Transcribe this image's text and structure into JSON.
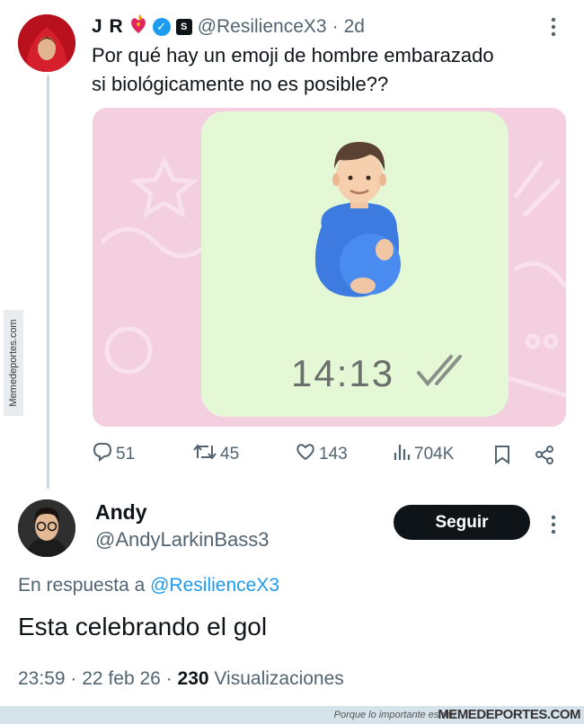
{
  "tweet": {
    "name": "J R",
    "handle": "@ResilienceX3",
    "separator": "·",
    "time": "2d",
    "text_line1": "Por qué hay un emoji de hombre embarazado",
    "text_line2": "si biológicamente no es posible??",
    "media": {
      "time_label": "14:13"
    },
    "stats": {
      "replies": "51",
      "retweets": "45",
      "likes": "143",
      "views": "704K"
    }
  },
  "reply": {
    "name": "Andy",
    "handle": "@AndyLarkinBass3",
    "follow_label": "Seguir",
    "in_reply_prefix": "En respuesta a",
    "in_reply_handle": "@ResilienceX3",
    "text": "Esta celebrando el gol",
    "time": "23:59",
    "sep1": "·",
    "date": "22 feb 26",
    "sep2": "·",
    "views_count": "230",
    "views_label": "Visualizaciones"
  },
  "watermark": {
    "side": "Memedeportes.com",
    "slogan": "Porque lo importante es reír",
    "brand": "MEMEDEPORTES.COM"
  },
  "colors": {
    "accent": "#1d9bf0",
    "text": "#0f1419",
    "muted": "#536471",
    "bubble": "#e4f8d6",
    "media_bg": "#f3cfe0"
  },
  "icons": [
    "heart-fire-icon",
    "verified-badge-icon",
    "affiliate-badge-icon",
    "more-icon",
    "reply-icon",
    "retweet-icon",
    "like-icon",
    "views-icon",
    "bookmark-icon",
    "share-icon",
    "double-check-icon",
    "pregnant-man-emoji"
  ]
}
